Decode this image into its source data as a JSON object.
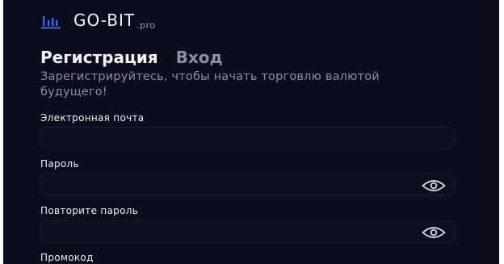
{
  "brand": {
    "name": "GO-BIT",
    "suffix": ".pro"
  },
  "tabs": {
    "register": "Регистрация",
    "login": "Вход"
  },
  "subtitle": "Зарегистрируйтесь, чтобы начать торговлю валютой будущего!",
  "form": {
    "email_label": "Электронная почта",
    "email_value": "",
    "password_label": "Пароль",
    "password_value": "",
    "repeat_label": "Повторите пароль",
    "repeat_value": "",
    "promo_label": "Промокод"
  },
  "colors": {
    "background": "#0b0c1c",
    "field_background": "#0d0e1f",
    "accent": "#3a64f5"
  },
  "icons": {
    "logo": "bar-chart-icon",
    "show_password": "eye-icon"
  }
}
